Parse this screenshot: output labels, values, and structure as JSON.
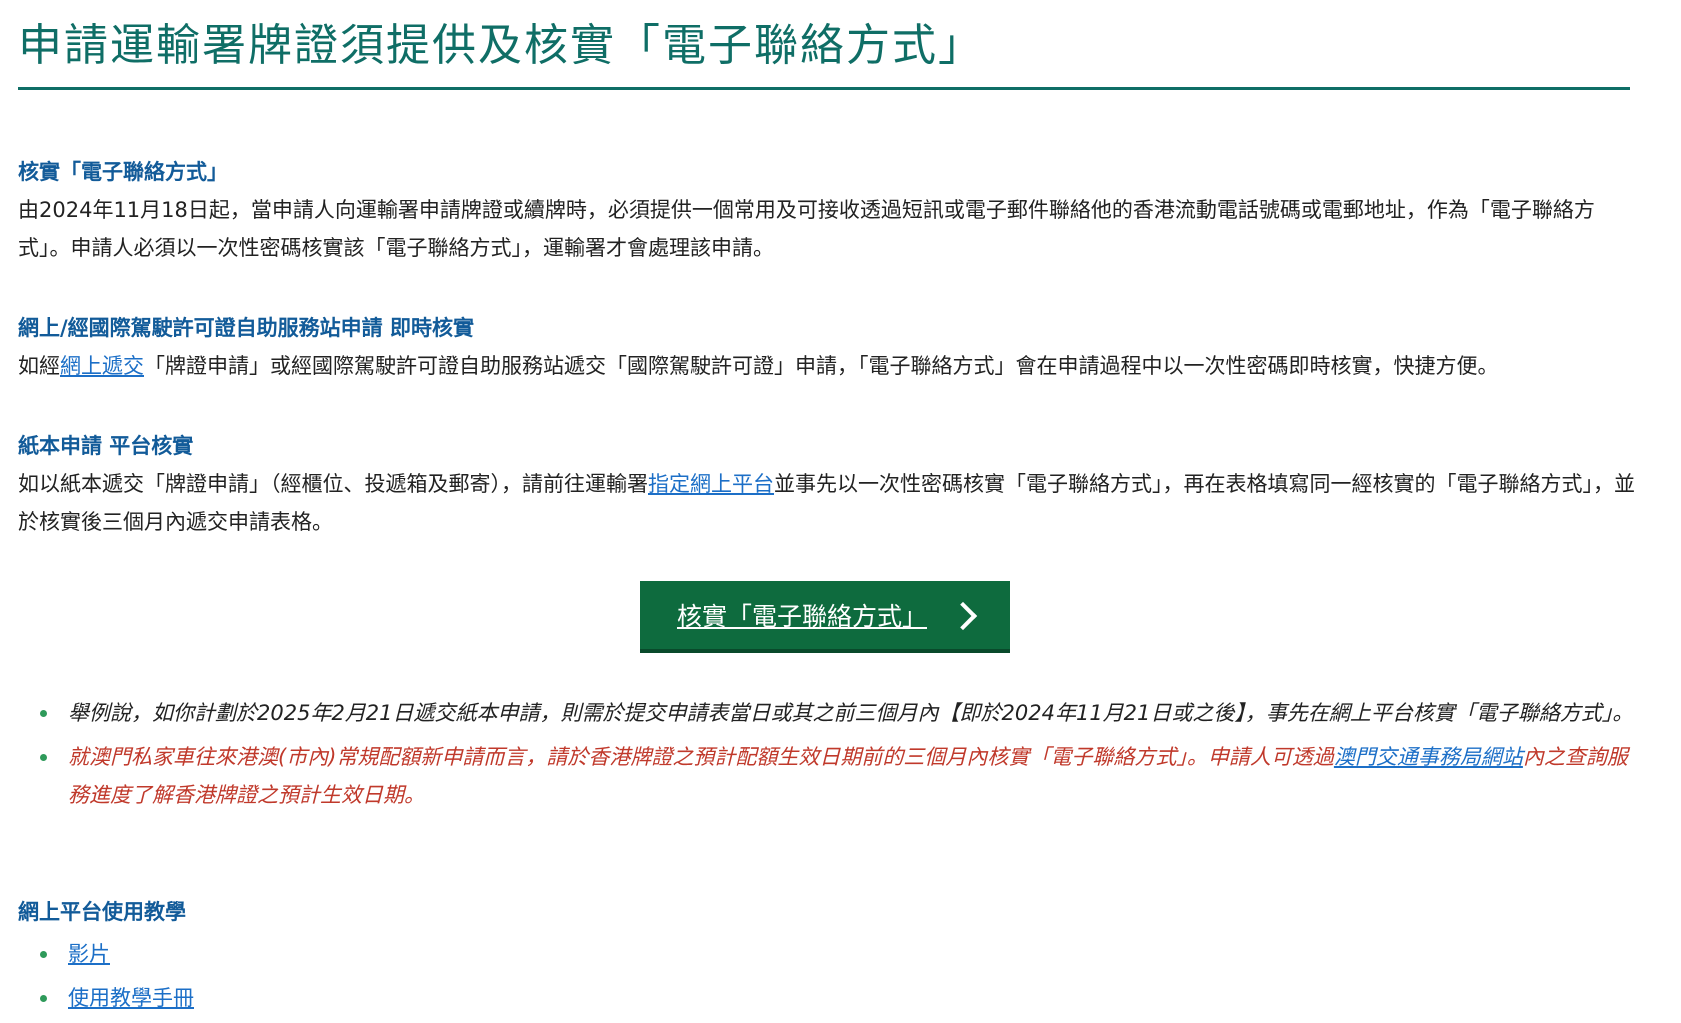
{
  "page": {
    "title": "申請運輸署牌證須提供及核實「電子聯絡方式」"
  },
  "sections": [
    {
      "heading": "核實「電子聯絡方式」",
      "body": "由2024年11月18日起，當申請人向運輸署申請牌證或續牌時，必須提供一個常用及可接收透過短訊或電子郵件聯絡他的香港流動電話號碼或電郵地址，作為「電子聯絡方式」。申請人必須以一次性密碼核實該「電子聯絡方式」，運輸署才會處理該申請。"
    },
    {
      "heading": "網上/經國際駕駛許可證自助服務站申請 即時核實",
      "body_prefix": "如經",
      "body_link": "網上遞交",
      "body_suffix": "「牌證申請」或經國際駕駛許可證自助服務站遞交「國際駕駛許可證」申請，「電子聯絡方式」會在申請過程中以一次性密碼即時核實，快捷方便。"
    },
    {
      "heading": "紙本申請 平台核實",
      "body_prefix": "如以紙本遞交「牌證申請」（經櫃位、投遞箱及郵寄），請前往運輸署",
      "body_link": "指定網上平台",
      "body_suffix": "並事先以一次性密碼核實「電子聯絡方式」，再在表格填寫同一經核實的「電子聯絡方式」，並於核實後三個月內遞交申請表格。"
    }
  ],
  "cta": {
    "label": "核實「電子聯絡方式」",
    "icon": "chevron-right-icon"
  },
  "notes": [
    {
      "text": "舉例說，如你計劃於2025年2月21日遞交紙本申請，則需於提交申請表當日或其之前三個月內【即於2024年11月21日或之後】，事先在網上平台核實「電子聯絡方式」。"
    },
    {
      "text_prefix": "就澳門私家車往來港澳(市內)常規配額新申請而言，請於香港牌證之預計配額生效日期前的三個月內核實「電子聯絡方式」。申請人可透過",
      "link": "澳門交通事務局網站",
      "text_suffix": "內之查詢服務進度了解香港牌證之預計生效日期。"
    }
  ],
  "tutorial": {
    "heading": "網上平台使用教學",
    "items": [
      "影片",
      "使用教學手冊"
    ]
  },
  "colors": {
    "title": "#0f6e66",
    "heading": "#125b99",
    "link": "#1c6fc7",
    "button": "#0e6b3e",
    "note_red": "#c0392b",
    "bullet": "#2e9a5a"
  }
}
